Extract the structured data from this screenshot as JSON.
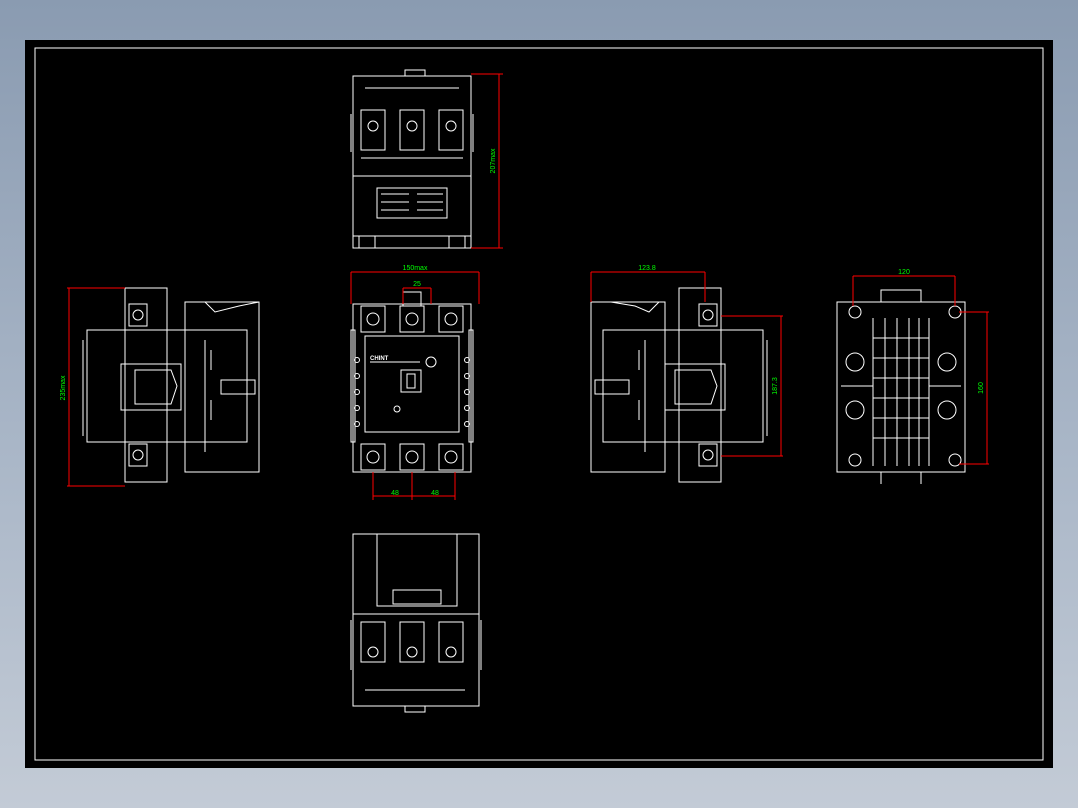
{
  "colors": {
    "background": "#000000",
    "geometry": "#ffffff",
    "dimension_line": "#ff0000",
    "dimension_text": "#00ff00",
    "desktop": "#9aa9bd"
  },
  "drawing": {
    "title": "",
    "front_view": {
      "width_label": "150max",
      "pitch_top_label": "25",
      "pitch_bottom_left_label": "48",
      "pitch_bottom_right_label": "48",
      "brand_text": "CHINT"
    },
    "top_view": {
      "height_label": "207max"
    },
    "left_view": {
      "height_label": "235max"
    },
    "right_view": {
      "width_label": "123.8",
      "height_label": "187.3"
    },
    "back_view": {
      "width_label": "120",
      "height_label": "160"
    }
  }
}
